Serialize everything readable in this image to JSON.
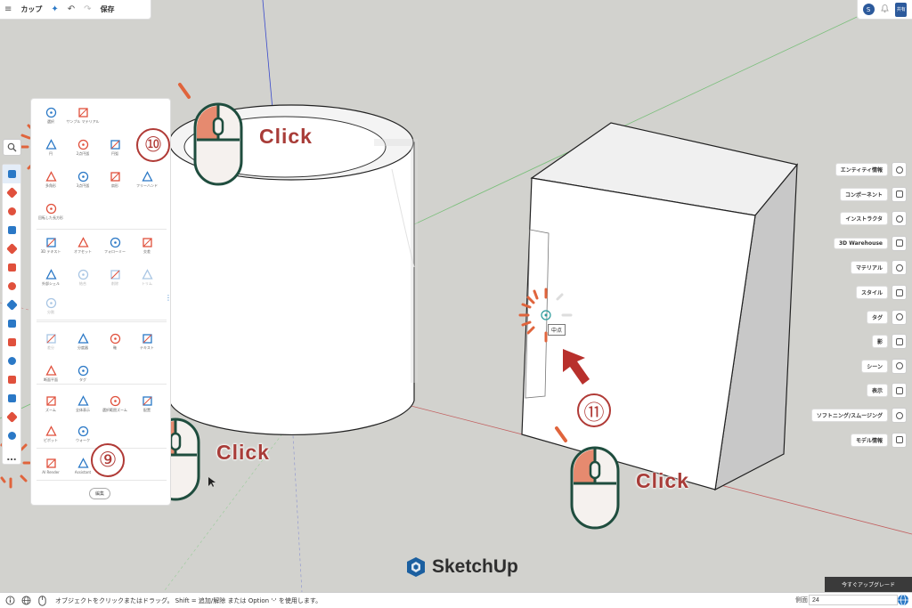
{
  "toolbar": {
    "menu_icon": "≡",
    "title": "カップ",
    "sparkle_icon": "✦",
    "undo_icon": "↶",
    "redo_icon": "↷",
    "save_label": "保存"
  },
  "header_right": {
    "avatar_letter": "S",
    "bell_icon": "🔔",
    "share_label": "共有"
  },
  "left_tools": [
    {
      "name": "select-tool",
      "color": "#2a78c6"
    },
    {
      "name": "eraser-tool",
      "color": "#e0503c"
    },
    {
      "name": "pencil-tool",
      "color": "#e0503c"
    },
    {
      "name": "rectangle-tool",
      "color": "#2a78c6"
    },
    {
      "name": "push-pull-tool",
      "color": "#e0503c"
    },
    {
      "name": "move-tool",
      "color": "#e0503c"
    },
    {
      "name": "rotate-tool",
      "color": "#e0503c"
    },
    {
      "name": "scale-tool",
      "color": "#2a78c6"
    },
    {
      "name": "paint-tool",
      "color": "#2a78c6"
    },
    {
      "name": "orbit-tool",
      "color": "#e0503c"
    },
    {
      "name": "tape-tool",
      "color": "#2a78c6"
    },
    {
      "name": "walk-tool",
      "color": "#e0503c"
    },
    {
      "name": "zoom-extents-tool",
      "color": "#2a78c6"
    },
    {
      "name": "section-tool",
      "color": "#e0503c"
    },
    {
      "name": "dimension-tool",
      "color": "#2a78c6"
    }
  ],
  "more_tools_label": "…",
  "tool_panel": {
    "tools": [
      {
        "name": "select-tool-item",
        "label": "選択",
        "dim": false
      },
      {
        "name": "sample-material-item",
        "label": "サンプル マテリアル",
        "dim": false
      },
      {
        "name": "circle-item",
        "label": "円",
        "dim": false
      },
      {
        "name": "2-point-arc-item",
        "label": "2点円弧",
        "dim": false
      },
      {
        "name": "arc-item",
        "label": "円弧",
        "dim": false
      },
      {
        "name": "polygon-item",
        "label": "多角形",
        "dim": false
      },
      {
        "name": "3-point-arc-item",
        "label": "3点円弧",
        "dim": false
      },
      {
        "name": "pie-item",
        "label": "扇形",
        "dim": false
      },
      {
        "name": "freehand-item",
        "label": "フリーハンド",
        "dim": false
      },
      {
        "name": "rotated-rectangle-item",
        "label": "回転した長方形",
        "dim": false
      },
      {
        "name": "3d-text-item",
        "label": "3D テキスト",
        "dim": false
      },
      {
        "name": "offset-item",
        "label": "オフセット",
        "dim": false
      },
      {
        "name": "follow-me-item",
        "label": "フォローミー",
        "dim": false
      },
      {
        "name": "intersect-item",
        "label": "交差",
        "dim": false
      },
      {
        "name": "outer-shell-item",
        "label": "外部シェル",
        "dim": false
      },
      {
        "name": "union-item",
        "label": "結合",
        "dim": true
      },
      {
        "name": "subtract-item",
        "label": "削除",
        "dim": true
      },
      {
        "name": "trim-item",
        "label": "トリム",
        "dim": true
      },
      {
        "name": "split-item",
        "label": "分割",
        "dim": true
      },
      {
        "name": "difference-item",
        "label": "差分",
        "dim": true
      },
      {
        "name": "protractor-item",
        "label": "分度器",
        "dim": false
      },
      {
        "name": "axes-item",
        "label": "軸",
        "dim": false
      },
      {
        "name": "text-item",
        "label": "テキスト",
        "dim": false
      },
      {
        "name": "section-plane-item",
        "label": "断面平面",
        "dim": false
      },
      {
        "name": "tag-item",
        "label": "タグ",
        "dim": false
      },
      {
        "name": "zoom-item",
        "label": "ズーム",
        "dim": false
      },
      {
        "name": "zoom-extents-item",
        "label": "全体表示",
        "dim": false
      },
      {
        "name": "zoom-window-item",
        "label": "選択範囲ズーム",
        "dim": false
      },
      {
        "name": "position-camera-item",
        "label": "配置",
        "dim": false
      },
      {
        "name": "look-around-item",
        "label": "ピボット",
        "dim": false
      },
      {
        "name": "walk-item",
        "label": "ウォーク",
        "dim": false
      },
      {
        "name": "ai-render-item",
        "label": "AI Render",
        "dim": false
      },
      {
        "name": "ai-assistant-item",
        "label": "Assistant",
        "dim": false
      }
    ],
    "edit_label": "編集"
  },
  "tray": [
    {
      "name": "entity-info",
      "label": "エンティティ情報"
    },
    {
      "name": "components",
      "label": "コンポーネント"
    },
    {
      "name": "instructor",
      "label": "インストラクタ"
    },
    {
      "name": "3d-warehouse",
      "label": "3D Warehouse"
    },
    {
      "name": "materials",
      "label": "マテリアル"
    },
    {
      "name": "styles",
      "label": "スタイル"
    },
    {
      "name": "tags",
      "label": "タグ"
    },
    {
      "name": "shadows",
      "label": "影"
    },
    {
      "name": "scenes",
      "label": "シーン"
    },
    {
      "name": "display",
      "label": "表示"
    },
    {
      "name": "soften-smooth",
      "label": "ソフトニング/スムージング"
    },
    {
      "name": "model-info",
      "label": "モデル情報"
    }
  ],
  "annotations": {
    "click_label": "Click",
    "step_9": "⑨",
    "step_10": "⑩",
    "step_11": "⑪"
  },
  "inference_tip": "中点",
  "logo_text": "SketchUp",
  "upgrade_label": "今すぐアップグレード",
  "status": {
    "message": "オブジェクトをクリックまたはドラッグ。 Shift = 追加/解除 または Option '-' を使用します。",
    "measure_label": "側面",
    "measure_value": "24"
  },
  "colors": {
    "accent_blue": "#2a78c6",
    "accent_red": "#e0503c",
    "annotation_red": "#a83c38",
    "mouse_outline": "#1f4d3e",
    "mouse_button": "#e68a6f",
    "arrow_red": "#b8302c"
  }
}
